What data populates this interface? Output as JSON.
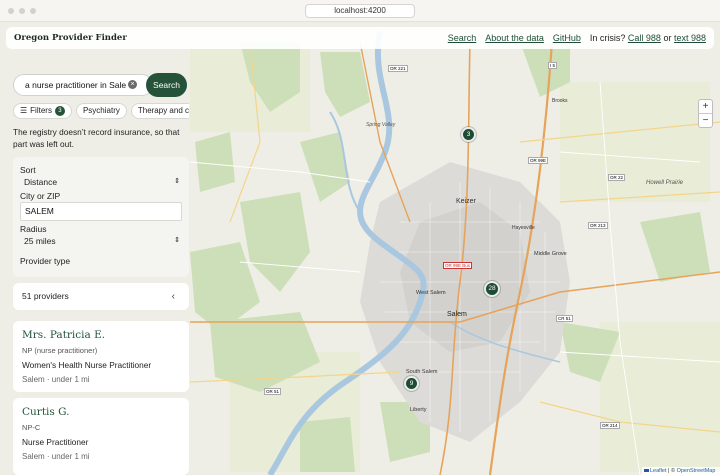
{
  "browser": {
    "url": "localhost:4200"
  },
  "header": {
    "brand": "Oregon Provider Finder",
    "nav": {
      "search": "Search",
      "about": "About the data",
      "github": "GitHub",
      "crisis_prefix": "In crisis?",
      "call": "Call 988",
      "or": "or",
      "text": "text 988"
    }
  },
  "search": {
    "value": "a nurse practitioner in Sale",
    "clear_icon": "close-icon",
    "button_label": "Search"
  },
  "chips": {
    "filters_label": "Filters",
    "filters_count": "3",
    "items": [
      "Psychiatry",
      "Therapy and c"
    ]
  },
  "note": "The registry doesn’t record insurance, so that part was left out.",
  "filters": {
    "sort_label": "Sort",
    "sort_value": "Distance",
    "city_label": "City or ZIP",
    "city_value": "SALEM",
    "radius_label": "Radius",
    "radius_value": "25 miles",
    "provider_type_label": "Provider type"
  },
  "results": {
    "count_label": "51 providers",
    "collapse_icon": "chevron-left-icon"
  },
  "providers": [
    {
      "name": "Mrs. Patricia E.",
      "credential": "NP (nurse practitioner)",
      "title": "Women's Health Nurse Practitioner",
      "meta": "Salem · under 1 mi"
    },
    {
      "name": "Curtis G.",
      "credential": "NP-C",
      "title": "Nurse Practitioner",
      "meta": "Salem · under 1 mi"
    }
  ],
  "map": {
    "zoom_in": "+",
    "zoom_out": "−",
    "clusters": [
      "3",
      "28",
      "9"
    ],
    "places": [
      "Keizer",
      "West Salem",
      "Salem",
      "South Salem",
      "Liberty",
      "Middle Grove",
      "Hayesville",
      "Brooks",
      "Howell Prairie",
      "Spring Valley",
      "Eola",
      "Lincoln",
      "Fairview",
      "Four Corners",
      "Sunnyslope"
    ],
    "road_shields": [
      "OR 221",
      "I 5",
      "OR 99E",
      "OR 22",
      "OR 213",
      "OR 99E Bus",
      "OR 51",
      "CR 51",
      "OR 214"
    ],
    "attribution": {
      "leaflet": "Leaflet",
      "sep": "| ©",
      "osm": "OpenStreetMap"
    },
    "colors": {
      "forest": "#cddfb8",
      "water": "#a9c8e0",
      "urban": "#dcdbd7",
      "primary_road": "#e6a35a",
      "brand_green": "#24533a"
    }
  }
}
